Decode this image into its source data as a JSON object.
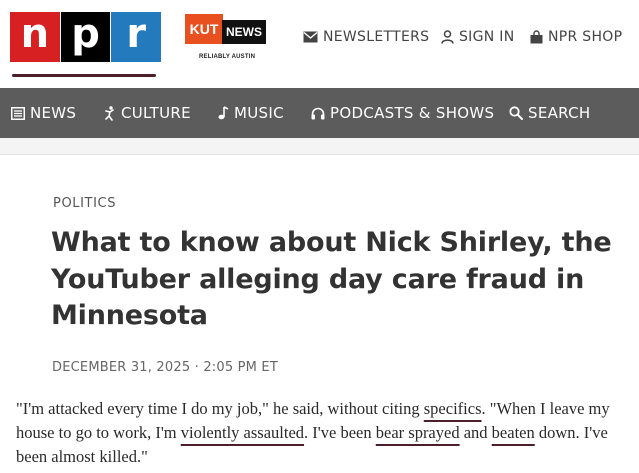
{
  "header": {
    "npr_logo": {
      "letters": [
        "n",
        "p",
        "r"
      ],
      "colors": [
        "#d62021",
        "#000000",
        "#237bbd"
      ]
    },
    "station_logo": {
      "kut": "KUT",
      "news": "NEWS",
      "tagline": "RELIABLY AUSTIN",
      "accent": "#e8501f"
    },
    "utility_links": [
      {
        "label": "NEWSLETTERS",
        "icon": "envelope-icon"
      },
      {
        "label": "SIGN IN",
        "icon": "user-icon"
      },
      {
        "label": "NPR SHOP",
        "icon": "shopping-bag-icon"
      }
    ]
  },
  "nav": {
    "background": "#5c5c5c",
    "items": [
      {
        "label": "NEWS",
        "icon": "newspaper-icon"
      },
      {
        "label": "CULTURE",
        "icon": "dancer-icon"
      },
      {
        "label": "MUSIC",
        "icon": "music-note-icon"
      },
      {
        "label": "PODCASTS & SHOWS",
        "icon": "headphones-icon"
      },
      {
        "label": "SEARCH",
        "icon": "search-icon"
      }
    ]
  },
  "article": {
    "section": "POLITICS",
    "headline": "What to know about Nick Shirley, the YouTuber alleging day care fraud in Minnesota",
    "dateline": "DECEMBER 31, 2025 · 2:05 PM ET",
    "quote_parts": [
      "\"I'm attacked every time I do my job,\" he said, without citing ",
      "specifics",
      ". \"When I leave my house to go to work, I'm ",
      "violently assaulted",
      ". I've been ",
      "bear sprayed",
      " and ",
      "beaten",
      " down. I've been almost killed.\""
    ],
    "annotation_color": "#4a1f2a"
  }
}
